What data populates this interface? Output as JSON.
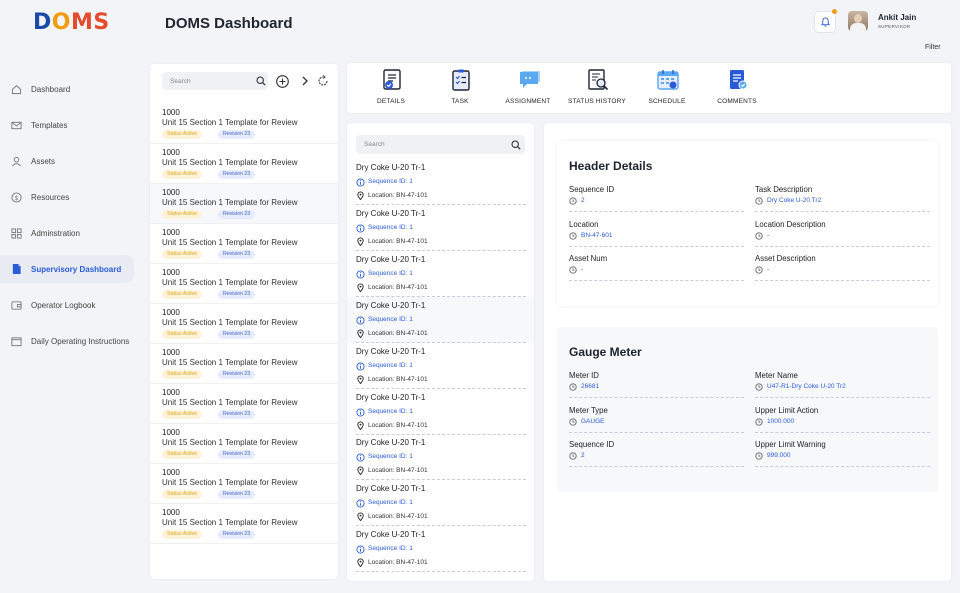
{
  "app": {
    "logo": [
      "D",
      "O",
      "M",
      "S"
    ],
    "page_title": "DOMS Dashboard"
  },
  "header": {
    "user_name": "Ankit Jain",
    "user_role": "SUPERVISOR",
    "filter_label": "Filter"
  },
  "sidebar": {
    "items": [
      {
        "label": "Dashboard",
        "icon": "home-icon"
      },
      {
        "label": "Templates",
        "icon": "mail-icon"
      },
      {
        "label": "Assets",
        "icon": "user-icon"
      },
      {
        "label": "Resources",
        "icon": "dollar-icon"
      },
      {
        "label": "Adminstration",
        "icon": "grid-icon"
      },
      {
        "label": "Supervisory Dashboard",
        "icon": "document-icon",
        "active": true
      },
      {
        "label": "Operator Logbook",
        "icon": "wallet-icon"
      },
      {
        "label": "Daily Operating Instructions",
        "icon": "folder-icon"
      }
    ]
  },
  "template_list": {
    "search_placeholder": "Search",
    "items": [
      {
        "number": "1000",
        "title": "Unit 15 Section 1 Template for Review",
        "status": "Status Active",
        "revision": "Revision 23"
      },
      {
        "number": "1000",
        "title": "Unit 15 Section 1 Template for Review",
        "status": "Status Active",
        "revision": "Revision 23"
      },
      {
        "number": "1000",
        "title": "Unit 15 Section 1 Template for Review",
        "status": "Status Active",
        "revision": "Revision 23"
      },
      {
        "number": "1000",
        "title": "Unit 15 Section 1 Template for Review",
        "status": "Status Active",
        "revision": "Revision 23"
      },
      {
        "number": "1000",
        "title": "Unit 15 Section 1 Template for Review",
        "status": "Status Active",
        "revision": "Revision 23"
      },
      {
        "number": "1000",
        "title": "Unit 15 Section 1 Template for Review",
        "status": "Status Active",
        "revision": "Revision 23"
      },
      {
        "number": "1000",
        "title": "Unit 15 Section 1 Template for Review",
        "status": "Status Active",
        "revision": "Revision 23"
      },
      {
        "number": "1000",
        "title": "Unit 15 Section 1 Template for Review",
        "status": "Status Active",
        "revision": "Revision 23"
      },
      {
        "number": "1000",
        "title": "Unit 15 Section 1 Template for Review",
        "status": "Status Active",
        "revision": "Revision 23"
      },
      {
        "number": "1000",
        "title": "Unit 15 Section 1 Template for Review",
        "status": "Status Active",
        "revision": "Revision 23"
      },
      {
        "number": "1000",
        "title": "Unit 15 Section 1 Template for Review",
        "status": "Status Active",
        "revision": "Revision 23"
      }
    ]
  },
  "tabs": [
    {
      "label": "DETAILS",
      "icon": "details-icon"
    },
    {
      "label": "TASK",
      "icon": "task-icon"
    },
    {
      "label": "ASSIGNMENT",
      "icon": "assignment-icon"
    },
    {
      "label": "STATUS HISTORY",
      "icon": "status-history-icon"
    },
    {
      "label": "SCHEDULE",
      "icon": "schedule-icon"
    },
    {
      "label": "COMMENTS",
      "icon": "comments-icon"
    }
  ],
  "task_list": {
    "search_placeholder": "Search",
    "items": [
      {
        "title": "Dry Coke U-20 Tr-1",
        "sequence": "Sequence ID: 1",
        "location": "Location: BN-47-101"
      },
      {
        "title": "Dry Coke U-20 Tr-1",
        "sequence": "Sequence ID: 1",
        "location": "Location: BN-47-101"
      },
      {
        "title": "Dry Coke U-20 Tr-1",
        "sequence": "Sequence ID: 1",
        "location": "Location: BN-47-101"
      },
      {
        "title": "Dry Coke U-20 Tr-1",
        "sequence": "Sequence ID: 1",
        "location": "Location: BN-47-101"
      },
      {
        "title": "Dry Coke U-20 Tr-1",
        "sequence": "Sequence ID: 1",
        "location": "Location: BN-47-101"
      },
      {
        "title": "Dry Coke U-20 Tr-1",
        "sequence": "Sequence ID: 1",
        "location": "Location: BN-47-101"
      },
      {
        "title": "Dry Coke U-20 Tr-1",
        "sequence": "Sequence ID: 1",
        "location": "Location: BN-47-101"
      },
      {
        "title": "Dry Coke U-20 Tr-1",
        "sequence": "Sequence ID: 1",
        "location": "Location: BN-47-101"
      },
      {
        "title": "Dry Coke U-20 Tr-1",
        "sequence": "Sequence ID: 1",
        "location": "Location: BN-47-101"
      }
    ]
  },
  "header_details": {
    "title": "Header Details",
    "fields": [
      {
        "label": "Sequence ID",
        "value": "2"
      },
      {
        "label": "Task Description",
        "value": "Dry Coke U-20 Tr2"
      },
      {
        "label": "Location",
        "value": "BN-47-601"
      },
      {
        "label": "Location Description",
        "value": "-"
      },
      {
        "label": "Asset Num",
        "value": "-"
      },
      {
        "label": "Asset Description",
        "value": "-"
      }
    ]
  },
  "gauge_meter": {
    "title": "Gauge Meter",
    "fields": [
      {
        "label": "Meter ID",
        "value": "26681"
      },
      {
        "label": "Meter Name",
        "value": "U47-R1-Dry Coke U-20 Tr2"
      },
      {
        "label": "Meter Type",
        "value": "GAUGE"
      },
      {
        "label": "Upper Limit Action",
        "value": "1000.000"
      },
      {
        "label": "Sequence ID",
        "value": "2"
      },
      {
        "label": "Upper Limit Warning",
        "value": "999.000"
      }
    ]
  },
  "colors": {
    "accent": "#2a5bd7",
    "logo_blue": "#1a4aa8",
    "logo_orange": "#f39c12",
    "logo_red": "#e34b2c",
    "status_active": "#e0a21a"
  }
}
